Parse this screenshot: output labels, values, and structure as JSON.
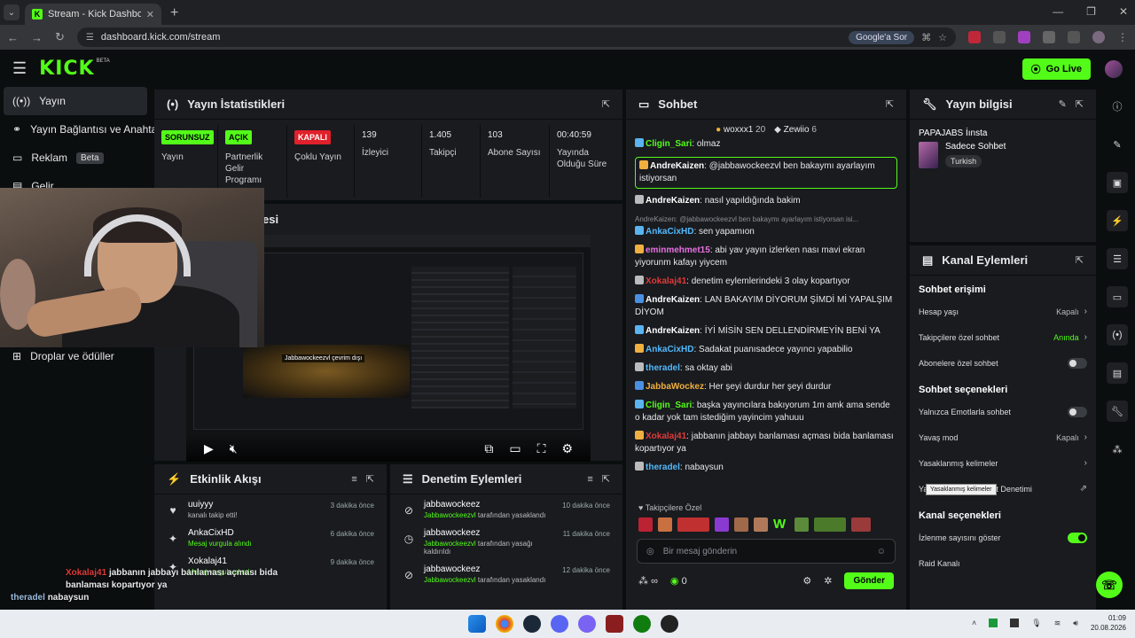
{
  "browser": {
    "tab_title": "Stream - Kick Dashboard",
    "url": "dashboard.kick.com/stream",
    "google_button": "Google'a Sor"
  },
  "header": {
    "logo": "KICK",
    "beta": "BETA",
    "go_live": "Go Live"
  },
  "nav": {
    "items": [
      {
        "label": "Yayın",
        "icon": "broadcast-icon"
      },
      {
        "label": "Yayın Bağlantısı ve Anahtar",
        "icon": "link-icon"
      },
      {
        "label": "Reklam",
        "icon": "ad-icon",
        "badge": "Beta"
      },
      {
        "label": "Gelir",
        "icon": "revenue-icon"
      },
      {
        "label": "Droplar ve ödüller",
        "icon": "gift-icon"
      }
    ]
  },
  "stats": {
    "title": "Yayın İstatistikleri",
    "items": [
      {
        "badge": "SORUNSUZ",
        "label": "Yayın"
      },
      {
        "badge": "AÇIK",
        "label": "Partnerlik Gelir Programı"
      },
      {
        "badge": "KAPALI",
        "label": "Çoklu Yayın"
      },
      {
        "value": "139",
        "label": "İzleyici"
      },
      {
        "value": "1.405",
        "label": "Takipçi"
      },
      {
        "value": "103",
        "label": "Abone Sayısı"
      },
      {
        "value": "00:40:59",
        "label": "Yayında Olduğu Süre"
      }
    ]
  },
  "preview": {
    "title_fragment": "esi",
    "mini_text": "Jabbawockeezvl çevrim dışı"
  },
  "activity": {
    "title": "Etkinlik Akışı",
    "rows": [
      {
        "icon": "heart-icon",
        "name": "uuiyyy",
        "sub": "kanalı takip etti!",
        "time": "3 dakika önce"
      },
      {
        "icon": "sparkle-icon",
        "name": "AnkaCixHD",
        "sub": "Mesaj vurgula alındı",
        "time": "6 dakika önce"
      },
      {
        "icon": "sparkle-icon",
        "name": "Xokalaj41",
        "sub": "Mesaj vurgula alındı",
        "time": "9 dakika önce"
      }
    ]
  },
  "modlog": {
    "title": "Denetim Eylemleri",
    "rows": [
      {
        "icon": "ban-icon",
        "name": "jabbawockeez",
        "by": "Jabbawockeezvl",
        "sub": " tarafından yasaklandı",
        "time": "10 dakika önce"
      },
      {
        "icon": "clock-icon",
        "name": "jabbawockeez",
        "by": "Jabbawockeezvl",
        "sub": " tarafından yasağı kaldırıldı",
        "time": "11 dakika önce"
      },
      {
        "icon": "ban-icon",
        "name": "jabbawockeez",
        "by": "Jabbawockeezvl",
        "sub": " tarafından yasaklandı",
        "time": "12 dakika önce"
      }
    ]
  },
  "chat": {
    "title": "Sohbet",
    "pinned": [
      {
        "name": "woxxx1",
        "count": "20"
      },
      {
        "name": "Zewiio",
        "count": "6"
      }
    ],
    "messages": [
      {
        "user": "Cligin_Sari",
        "color": "#53fc18",
        "text": "olmaz"
      },
      {
        "user": "AndreKaizen",
        "color": "#ffffff",
        "text": "@jabbawockeezvl ben bakaymı ayarlayım istiyorsan",
        "highlight": true
      },
      {
        "user": "AndreKaizen",
        "color": "#ffffff",
        "text": "nasıl yapıldığında bakim"
      },
      {
        "reply": "AndreKaizen: @jabbawockeezvl ben bakaymı ayarlayım istiyorsan isi..."
      },
      {
        "user": "AnkaCixHD",
        "color": "#53b9fc",
        "text": "sen yapamıon"
      },
      {
        "user": "eminmehmet15",
        "color": "#e870e0",
        "text": "abi yav yayın izlerken nası mavi ekran yiyorunm kafayı yiycem"
      },
      {
        "user": "Xokalaj41",
        "color": "#e03a3a",
        "text": "denetim eylemlerindeki 3 olay kopartıyor"
      },
      {
        "user": "AndreKaizen",
        "color": "#ffffff",
        "text": "LAN BAKAYIM DİYORUM ŞİMDİ Mİ YAPALŞIM DİYOM"
      },
      {
        "user": "AndreKaizen",
        "color": "#ffffff",
        "text": "İYİ MİSİN SEN DELLENDİRMEYİN BENİ YA"
      },
      {
        "user": "AnkaCixHD",
        "color": "#53b9fc",
        "text": "Sadakat puanısadece yayıncı yapabilio"
      },
      {
        "user": "theradel",
        "color": "#53b9fc",
        "text": "sa oktay abi"
      },
      {
        "user": "JabbaWockez",
        "color": "#f0b040",
        "text": "Her şeyi durdur her şeyi durdur"
      },
      {
        "user": "Cligin_Sari",
        "color": "#53fc18",
        "text": "başka yayıncılara bakıyorum 1m amk ama sende o kadar yok tam istediğim yayincim yahuuu"
      },
      {
        "user": "Xokalaj41",
        "color": "#e03a3a",
        "text": "jabbanın jabbayı banlaması açması bida banlaması kopartıyor ya"
      },
      {
        "user": "theradel",
        "color": "#53b9fc",
        "text": "nabaysun"
      }
    ],
    "subscribers_label": "Takipçilere Özel",
    "input_placeholder": "Bir mesaj gönderin",
    "infinity": "∞",
    "points": "0",
    "send": "Gönder"
  },
  "stream_info": {
    "title": "Yayın bilgisi",
    "stream_title": "PAPAJABS İınsta",
    "category": "Sadece Sohbet",
    "tag": "Turkish"
  },
  "channel_actions": {
    "title": "Kanal Eylemleri",
    "sections": [
      {
        "heading": "Sohbet erişimi",
        "options": [
          {
            "label": "Hesap yaşı",
            "value": "Kapalı",
            "type": "chevron"
          },
          {
            "label": "Takipçilere özel sohbet",
            "value": "Anında",
            "type": "chevron",
            "green": true
          },
          {
            "label": "Abonelere özel sohbet",
            "type": "toggle",
            "on": false
          }
        ]
      },
      {
        "heading": "Sohbet seçenekleri",
        "options": [
          {
            "label": "Yalnızca Emotlarla sohbet",
            "type": "toggle",
            "on": false
          },
          {
            "label": "Yavaş mod",
            "value": "Kapalı",
            "type": "chevron"
          },
          {
            "label": "Yasaklanmış kelimeler",
            "type": "chevron"
          },
          {
            "label": "Yapay Zeka ile Sohbet Denetimi",
            "type": "external"
          }
        ]
      },
      {
        "heading": "Kanal seçenekleri",
        "options": [
          {
            "label": "İzlenme sayısını göster",
            "type": "toggle",
            "on": true
          },
          {
            "label": "Raid Kanalı",
            "type": "none"
          }
        ]
      }
    ],
    "tooltip": "Yasaklanmış kelimeler"
  },
  "overlay_chat": [
    {
      "user": "Xokalaj41",
      "text": "jabbanın jabbayı banlaması açması bida banlaması kopartıyor ya"
    },
    {
      "user": "theradel",
      "text": "nabaysun"
    }
  ],
  "taskbar": {
    "time": "01:09",
    "date": "20.08.2026"
  },
  "colors": {
    "accent": "#53fc18",
    "panel": "#191b1f",
    "bg": "#0b0e0f"
  }
}
